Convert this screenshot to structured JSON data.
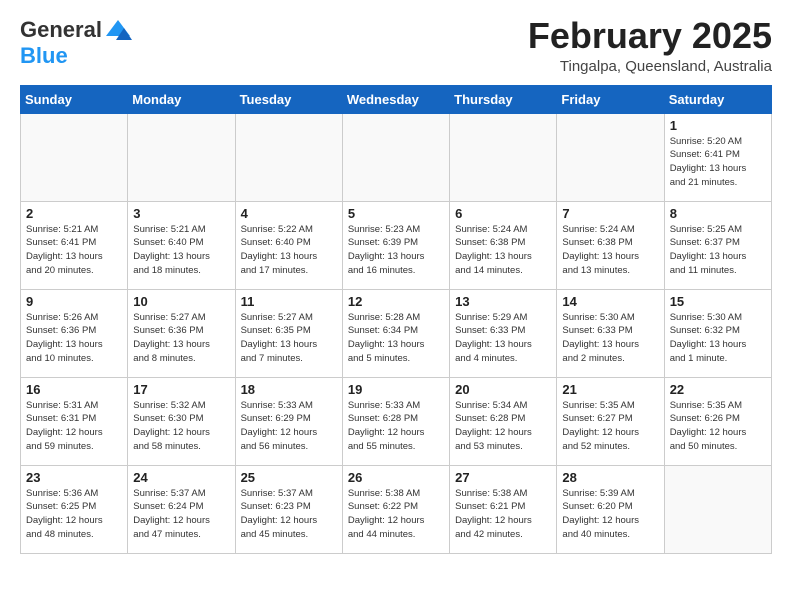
{
  "logo": {
    "general": "General",
    "blue": "Blue"
  },
  "title": "February 2025",
  "subtitle": "Tingalpa, Queensland, Australia",
  "weekdays": [
    "Sunday",
    "Monday",
    "Tuesday",
    "Wednesday",
    "Thursday",
    "Friday",
    "Saturday"
  ],
  "weeks": [
    [
      {
        "day": "",
        "info": ""
      },
      {
        "day": "",
        "info": ""
      },
      {
        "day": "",
        "info": ""
      },
      {
        "day": "",
        "info": ""
      },
      {
        "day": "",
        "info": ""
      },
      {
        "day": "",
        "info": ""
      },
      {
        "day": "1",
        "info": "Sunrise: 5:20 AM\nSunset: 6:41 PM\nDaylight: 13 hours\nand 21 minutes."
      }
    ],
    [
      {
        "day": "2",
        "info": "Sunrise: 5:21 AM\nSunset: 6:41 PM\nDaylight: 13 hours\nand 20 minutes."
      },
      {
        "day": "3",
        "info": "Sunrise: 5:21 AM\nSunset: 6:40 PM\nDaylight: 13 hours\nand 18 minutes."
      },
      {
        "day": "4",
        "info": "Sunrise: 5:22 AM\nSunset: 6:40 PM\nDaylight: 13 hours\nand 17 minutes."
      },
      {
        "day": "5",
        "info": "Sunrise: 5:23 AM\nSunset: 6:39 PM\nDaylight: 13 hours\nand 16 minutes."
      },
      {
        "day": "6",
        "info": "Sunrise: 5:24 AM\nSunset: 6:38 PM\nDaylight: 13 hours\nand 14 minutes."
      },
      {
        "day": "7",
        "info": "Sunrise: 5:24 AM\nSunset: 6:38 PM\nDaylight: 13 hours\nand 13 minutes."
      },
      {
        "day": "8",
        "info": "Sunrise: 5:25 AM\nSunset: 6:37 PM\nDaylight: 13 hours\nand 11 minutes."
      }
    ],
    [
      {
        "day": "9",
        "info": "Sunrise: 5:26 AM\nSunset: 6:36 PM\nDaylight: 13 hours\nand 10 minutes."
      },
      {
        "day": "10",
        "info": "Sunrise: 5:27 AM\nSunset: 6:36 PM\nDaylight: 13 hours\nand 8 minutes."
      },
      {
        "day": "11",
        "info": "Sunrise: 5:27 AM\nSunset: 6:35 PM\nDaylight: 13 hours\nand 7 minutes."
      },
      {
        "day": "12",
        "info": "Sunrise: 5:28 AM\nSunset: 6:34 PM\nDaylight: 13 hours\nand 5 minutes."
      },
      {
        "day": "13",
        "info": "Sunrise: 5:29 AM\nSunset: 6:33 PM\nDaylight: 13 hours\nand 4 minutes."
      },
      {
        "day": "14",
        "info": "Sunrise: 5:30 AM\nSunset: 6:33 PM\nDaylight: 13 hours\nand 2 minutes."
      },
      {
        "day": "15",
        "info": "Sunrise: 5:30 AM\nSunset: 6:32 PM\nDaylight: 13 hours\nand 1 minute."
      }
    ],
    [
      {
        "day": "16",
        "info": "Sunrise: 5:31 AM\nSunset: 6:31 PM\nDaylight: 12 hours\nand 59 minutes."
      },
      {
        "day": "17",
        "info": "Sunrise: 5:32 AM\nSunset: 6:30 PM\nDaylight: 12 hours\nand 58 minutes."
      },
      {
        "day": "18",
        "info": "Sunrise: 5:33 AM\nSunset: 6:29 PM\nDaylight: 12 hours\nand 56 minutes."
      },
      {
        "day": "19",
        "info": "Sunrise: 5:33 AM\nSunset: 6:28 PM\nDaylight: 12 hours\nand 55 minutes."
      },
      {
        "day": "20",
        "info": "Sunrise: 5:34 AM\nSunset: 6:28 PM\nDaylight: 12 hours\nand 53 minutes."
      },
      {
        "day": "21",
        "info": "Sunrise: 5:35 AM\nSunset: 6:27 PM\nDaylight: 12 hours\nand 52 minutes."
      },
      {
        "day": "22",
        "info": "Sunrise: 5:35 AM\nSunset: 6:26 PM\nDaylight: 12 hours\nand 50 minutes."
      }
    ],
    [
      {
        "day": "23",
        "info": "Sunrise: 5:36 AM\nSunset: 6:25 PM\nDaylight: 12 hours\nand 48 minutes."
      },
      {
        "day": "24",
        "info": "Sunrise: 5:37 AM\nSunset: 6:24 PM\nDaylight: 12 hours\nand 47 minutes."
      },
      {
        "day": "25",
        "info": "Sunrise: 5:37 AM\nSunset: 6:23 PM\nDaylight: 12 hours\nand 45 minutes."
      },
      {
        "day": "26",
        "info": "Sunrise: 5:38 AM\nSunset: 6:22 PM\nDaylight: 12 hours\nand 44 minutes."
      },
      {
        "day": "27",
        "info": "Sunrise: 5:38 AM\nSunset: 6:21 PM\nDaylight: 12 hours\nand 42 minutes."
      },
      {
        "day": "28",
        "info": "Sunrise: 5:39 AM\nSunset: 6:20 PM\nDaylight: 12 hours\nand 40 minutes."
      },
      {
        "day": "",
        "info": ""
      }
    ]
  ]
}
